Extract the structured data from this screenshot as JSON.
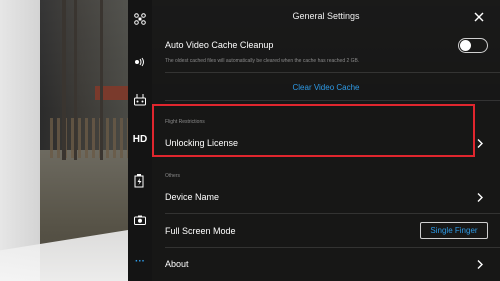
{
  "header": {
    "title": "General Settings",
    "close_icon": "close-icon"
  },
  "sidebar": {
    "items": [
      {
        "name": "aircraft-icon"
      },
      {
        "name": "remote-signal-icon"
      },
      {
        "name": "remote-controller-icon"
      },
      {
        "name": "hd-transmission-icon",
        "label": "HD"
      },
      {
        "name": "battery-icon"
      },
      {
        "name": "camera-icon"
      },
      {
        "name": "more-icon",
        "label": "···"
      }
    ],
    "active_color": "#2e9ae6"
  },
  "settings": {
    "auto_cache": {
      "title": "Auto Video Cache Cleanup",
      "description": "The oldest cached files will automatically be cleared when the cache has reached 2 GB.",
      "enabled": false
    },
    "clear_cache": {
      "label": "Clear Video Cache"
    },
    "flight_restrictions": {
      "section_label": "Flight Restrictions",
      "unlocking_license": "Unlocking License"
    },
    "others": {
      "section_label": "Others",
      "device_name": "Device Name",
      "full_screen_mode": "Full Screen Mode",
      "full_screen_value": "Single Finger",
      "about": "About"
    }
  },
  "colors": {
    "accent": "#2e9ae6",
    "highlight": "#e0262e"
  }
}
